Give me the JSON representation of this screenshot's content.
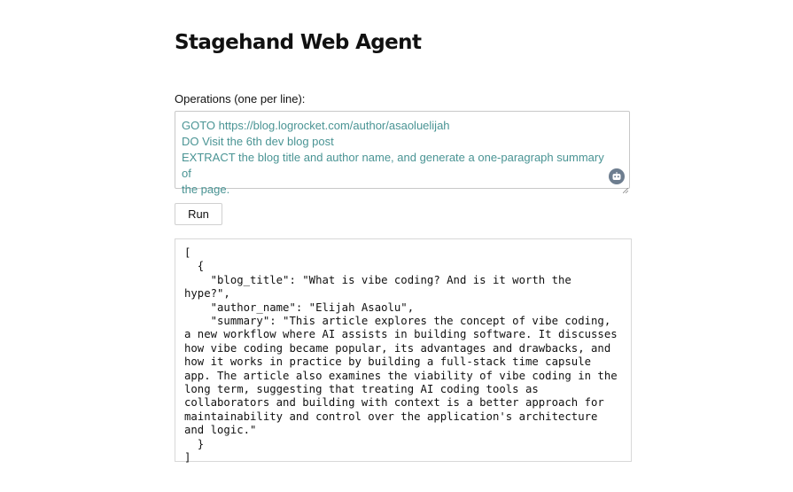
{
  "page": {
    "title": "Stagehand Web Agent"
  },
  "operations": {
    "label": "Operations (one per line):",
    "lines": [
      "GOTO https://blog.logrocket.com/author/asaoluelijah",
      "DO Visit the 6th dev blog post",
      "EXTRACT the blog title and author name, and generate a one-paragraph summary of",
      "the page."
    ],
    "text_color": "#4a9494",
    "assist_icon": "robot-icon"
  },
  "run_button": {
    "label": "Run"
  },
  "output": {
    "lines": [
      "[",
      "  {",
      "    \"blog_title\": \"What is vibe coding? And is it worth the",
      "hype?\",",
      "    \"author_name\": \"Elijah Asaolu\",",
      "    \"summary\": \"This article explores the concept of vibe coding,",
      "a new workflow where AI assists in building software. It discusses",
      "how vibe coding became popular, its advantages and drawbacks, and",
      "how it works in practice by building a full-stack time capsule",
      "app. The article also examines the viability of vibe coding in the",
      "long term, suggesting that treating AI coding tools as",
      "collaborators and building with context is a better approach for",
      "maintainability and control over the application's architecture",
      "and logic.\"",
      "  }",
      "]"
    ]
  }
}
